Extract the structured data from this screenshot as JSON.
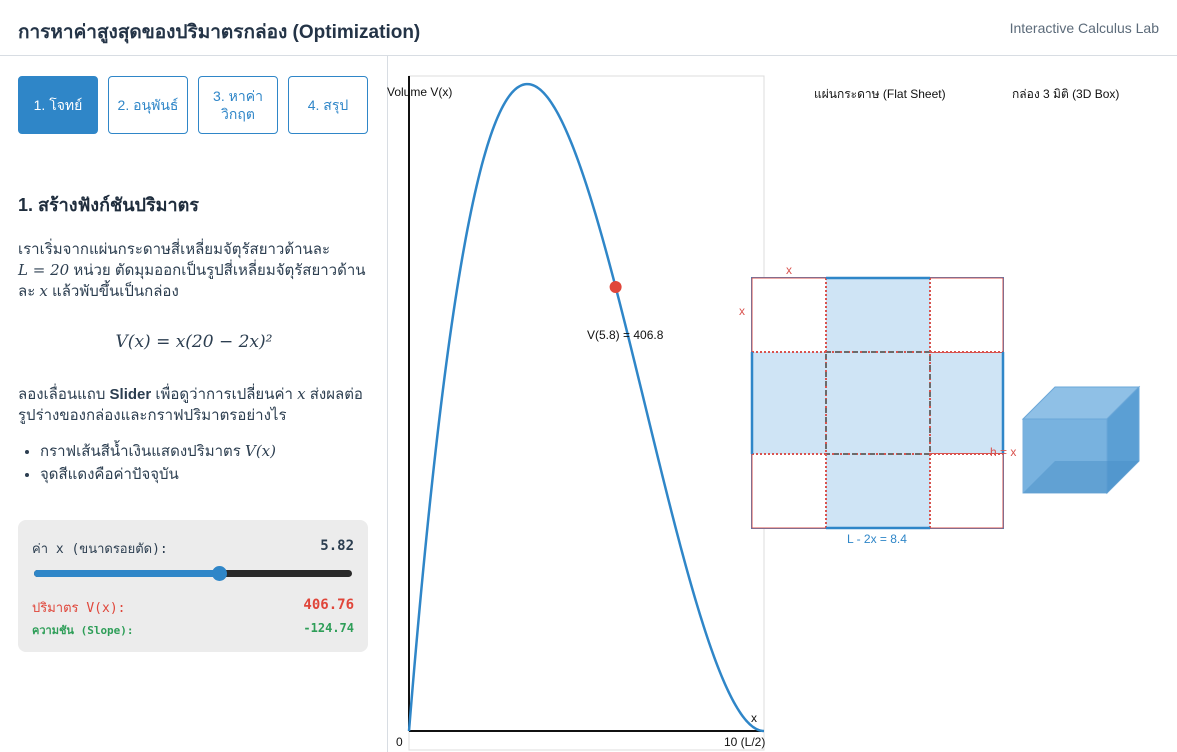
{
  "header": {
    "title": "การหาค่าสูงสุดของปริมาตรกล่อง (Optimization)",
    "brand": "Interactive Calculus Lab"
  },
  "steps": [
    {
      "label": "1. โจทย์",
      "active": true
    },
    {
      "label": "2. อนุพันธ์",
      "active": false
    },
    {
      "label": "3. หาค่าวิกฤต",
      "active": false
    },
    {
      "label": "4. สรุป",
      "active": false
    }
  ],
  "content": {
    "heading": "1. สร้างฟังก์ชันปริมาตร",
    "intro_1": "เราเริ่มจากแผ่นกระดาษสี่เหลี่ยมจัตุรัสยาวด้านละ",
    "intro_math_L": "L = 20",
    "intro_2": " หน่วย ตัดมุมออกเป็นรูปสี่เหลี่ยมจัตุรัสยาวด้านละ ",
    "intro_math_x": "x",
    "intro_3": " แล้วพับขึ้นเป็นกล่อง",
    "formula": "V(x) = x(20 − 2x)²",
    "instr_1": "ลองเลื่อนแถบ ",
    "instr_bold": "Slider",
    "instr_2": " เพื่อดูว่าการเปลี่ยนค่า ",
    "instr_math": "x",
    "instr_3": " ส่งผลต่อรูปร่างของกล่องและกราฟปริมาตรอย่างไร",
    "bullet_1": "กราฟเส้นสีน้ำเงินแสดงปริมาตร ",
    "bullet_1_math": "V(x)",
    "bullet_2": "จุดสีแดงคือค่าปัจจุบัน"
  },
  "panel": {
    "x_label": "ค่า x (ขนาดรอยตัด):",
    "x_value": "5.82",
    "x_fraction": 0.582,
    "volume_label": "ปริมาตร V(x):",
    "volume_value": "406.76",
    "slope_label": "ความชัน (Slope):",
    "slope_value": "-124.74"
  },
  "graph": {
    "y_label": "Volume V(x)",
    "x_axis_label": "x",
    "x_min_label": "0",
    "x_max_label": "10 (L/2)",
    "point_label": "V(5.8) = 406.8",
    "flat_sheet_label": "แผ่นกระดาษ (Flat Sheet)",
    "box_label": "กล่อง 3 มิติ (3D Box)",
    "cut_x_top": "x",
    "cut_x_left": "x",
    "height_label": "h = x",
    "base_label": "L - 2x = 8.4"
  },
  "chart_data": {
    "type": "line",
    "x_range": [
      0,
      10
    ],
    "y_range": [
      0,
      600
    ],
    "function": "V(x) = x(20 - 2x)^2",
    "current_point": {
      "x": 5.82,
      "y": 406.76
    },
    "colors": {
      "curve": "#2f86c8",
      "point": "#e0463a"
    }
  },
  "colors": {
    "accent": "#2f86c8",
    "volume": "#e0463a",
    "slope": "#2e9e58",
    "cut_line": "#d9534f",
    "fold_line": "#6b6b6b",
    "box_fill": "#5b9fd4",
    "sheet_fill": "#cfe4f5"
  }
}
